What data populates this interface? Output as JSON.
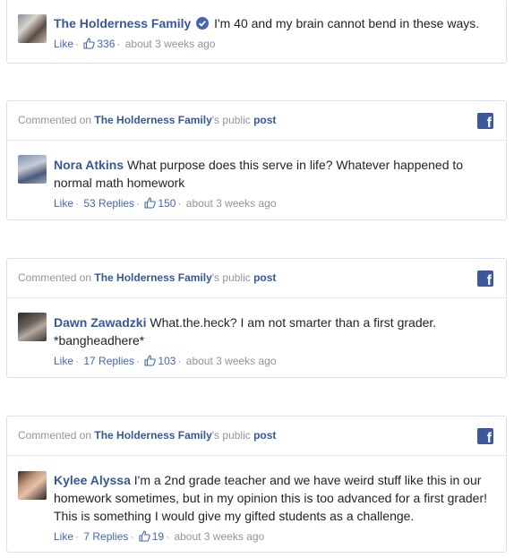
{
  "head_prefix": "Commented on",
  "head_owner_suffix": "'s public",
  "head_post": "post",
  "fb_glyph": "f",
  "sep": "·",
  "top_comment": {
    "name": "The Holderness Family",
    "verified": true,
    "text": "I'm 40 and my brain cannot bend in these ways.",
    "like": "Like",
    "likes": "336",
    "time": "about 3 weeks ago"
  },
  "cards": [
    {
      "page": "The Holderness Family",
      "name": "Nora Atkins",
      "text": "What purpose does this serve in life? Whatever happened to normal math homework",
      "like": "Like",
      "replies": "53 Replies",
      "likes": "150",
      "time": "about 3 weeks ago"
    },
    {
      "page": "The Holderness Family",
      "name": "Dawn Zawadzki",
      "text": "What.the.heck? I am not smarter than a first grader. *bangheadhere*",
      "like": "Like",
      "replies": "17 Replies",
      "likes": "103",
      "time": "about 3 weeks ago"
    },
    {
      "page": "The Holderness Family",
      "name": "Kylee Alyssa",
      "text": "I'm a 2nd grade teacher and we have weird stuff like this in our homework sometimes, but in my opinion this is too advanced for a first grader! This is something I would give my gifted students as a challenge.",
      "like": "Like",
      "replies": "7 Replies",
      "likes": "19",
      "time": "about 3 weeks ago"
    }
  ],
  "colors": {
    "link": "#365899",
    "meta": "#90949c",
    "brand": "#3b5998",
    "verified": "#4267b2"
  }
}
